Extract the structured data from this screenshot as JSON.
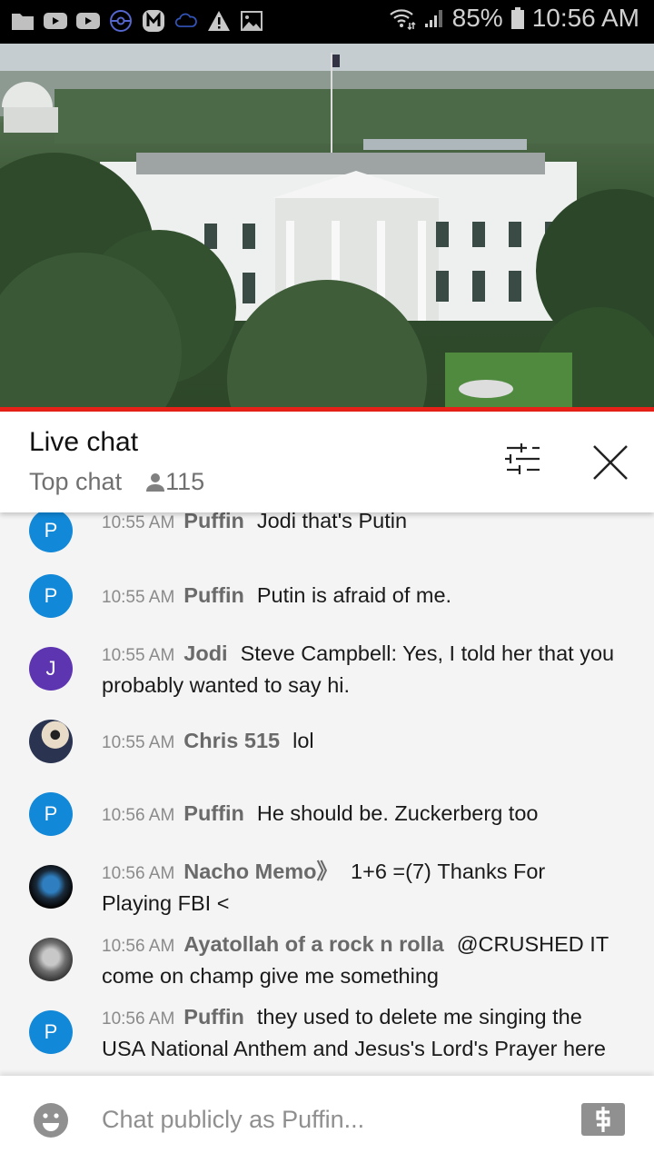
{
  "status_bar": {
    "notification_icons": [
      "folder-icon",
      "youtube-icon",
      "youtube-icon",
      "pokeball-icon",
      "m-app-icon",
      "cloud-icon",
      "warning-icon",
      "image-icon"
    ],
    "battery_percent": "85%",
    "time": "10:56 AM",
    "colors": {
      "pokeball": "#5566cc",
      "cloud": "#3355bb"
    }
  },
  "video": {
    "description": "Live camera view of the White House",
    "progress_color": "#e62117"
  },
  "chat_header": {
    "title": "Live chat",
    "mode": "Top chat",
    "viewer_count": "115"
  },
  "messages": [
    {
      "time": "10:55 AM",
      "author": "Puffin",
      "text": "Jodi that's Putin",
      "avatar_letter": "P",
      "avatar_color": "#1188d8"
    },
    {
      "time": "10:55 AM",
      "author": "Puffin",
      "text": "Putin is afraid of me.",
      "avatar_letter": "P",
      "avatar_color": "#1188d8"
    },
    {
      "time": "10:55 AM",
      "author": "Jodi",
      "text": "Steve Campbell: Yes, I told her that you probably wanted to say hi.",
      "avatar_letter": "J",
      "avatar_color": "#5e35b1"
    },
    {
      "time": "10:55 AM",
      "author": "Chris 515",
      "text": "lol",
      "avatar_letter": "",
      "avatar_color": "#e8dcc8"
    },
    {
      "time": "10:56 AM",
      "author": "Puffin",
      "text": "He should be. Zuckerberg too",
      "avatar_letter": "P",
      "avatar_color": "#1188d8"
    },
    {
      "time": "10:56 AM",
      "author": "Nacho Memo》",
      "text": "1+6 =(7) Thanks For Playing FBI <",
      "avatar_letter": "",
      "avatar_color": "#1a2a3a"
    },
    {
      "time": "10:56 AM",
      "author": "Ayatollah of a rock n rolla",
      "text": "@CRUSHED IT come on champ give me something",
      "avatar_letter": "",
      "avatar_color": "#8a8a8a"
    },
    {
      "time": "10:56 AM",
      "author": "Puffin",
      "text": "they used to delete me singing the USA National Anthem and Jesus's Lord's Prayer here",
      "avatar_letter": "P",
      "avatar_color": "#1188d8"
    }
  ],
  "composer": {
    "placeholder": "Chat publicly as Puffin...",
    "value": ""
  }
}
